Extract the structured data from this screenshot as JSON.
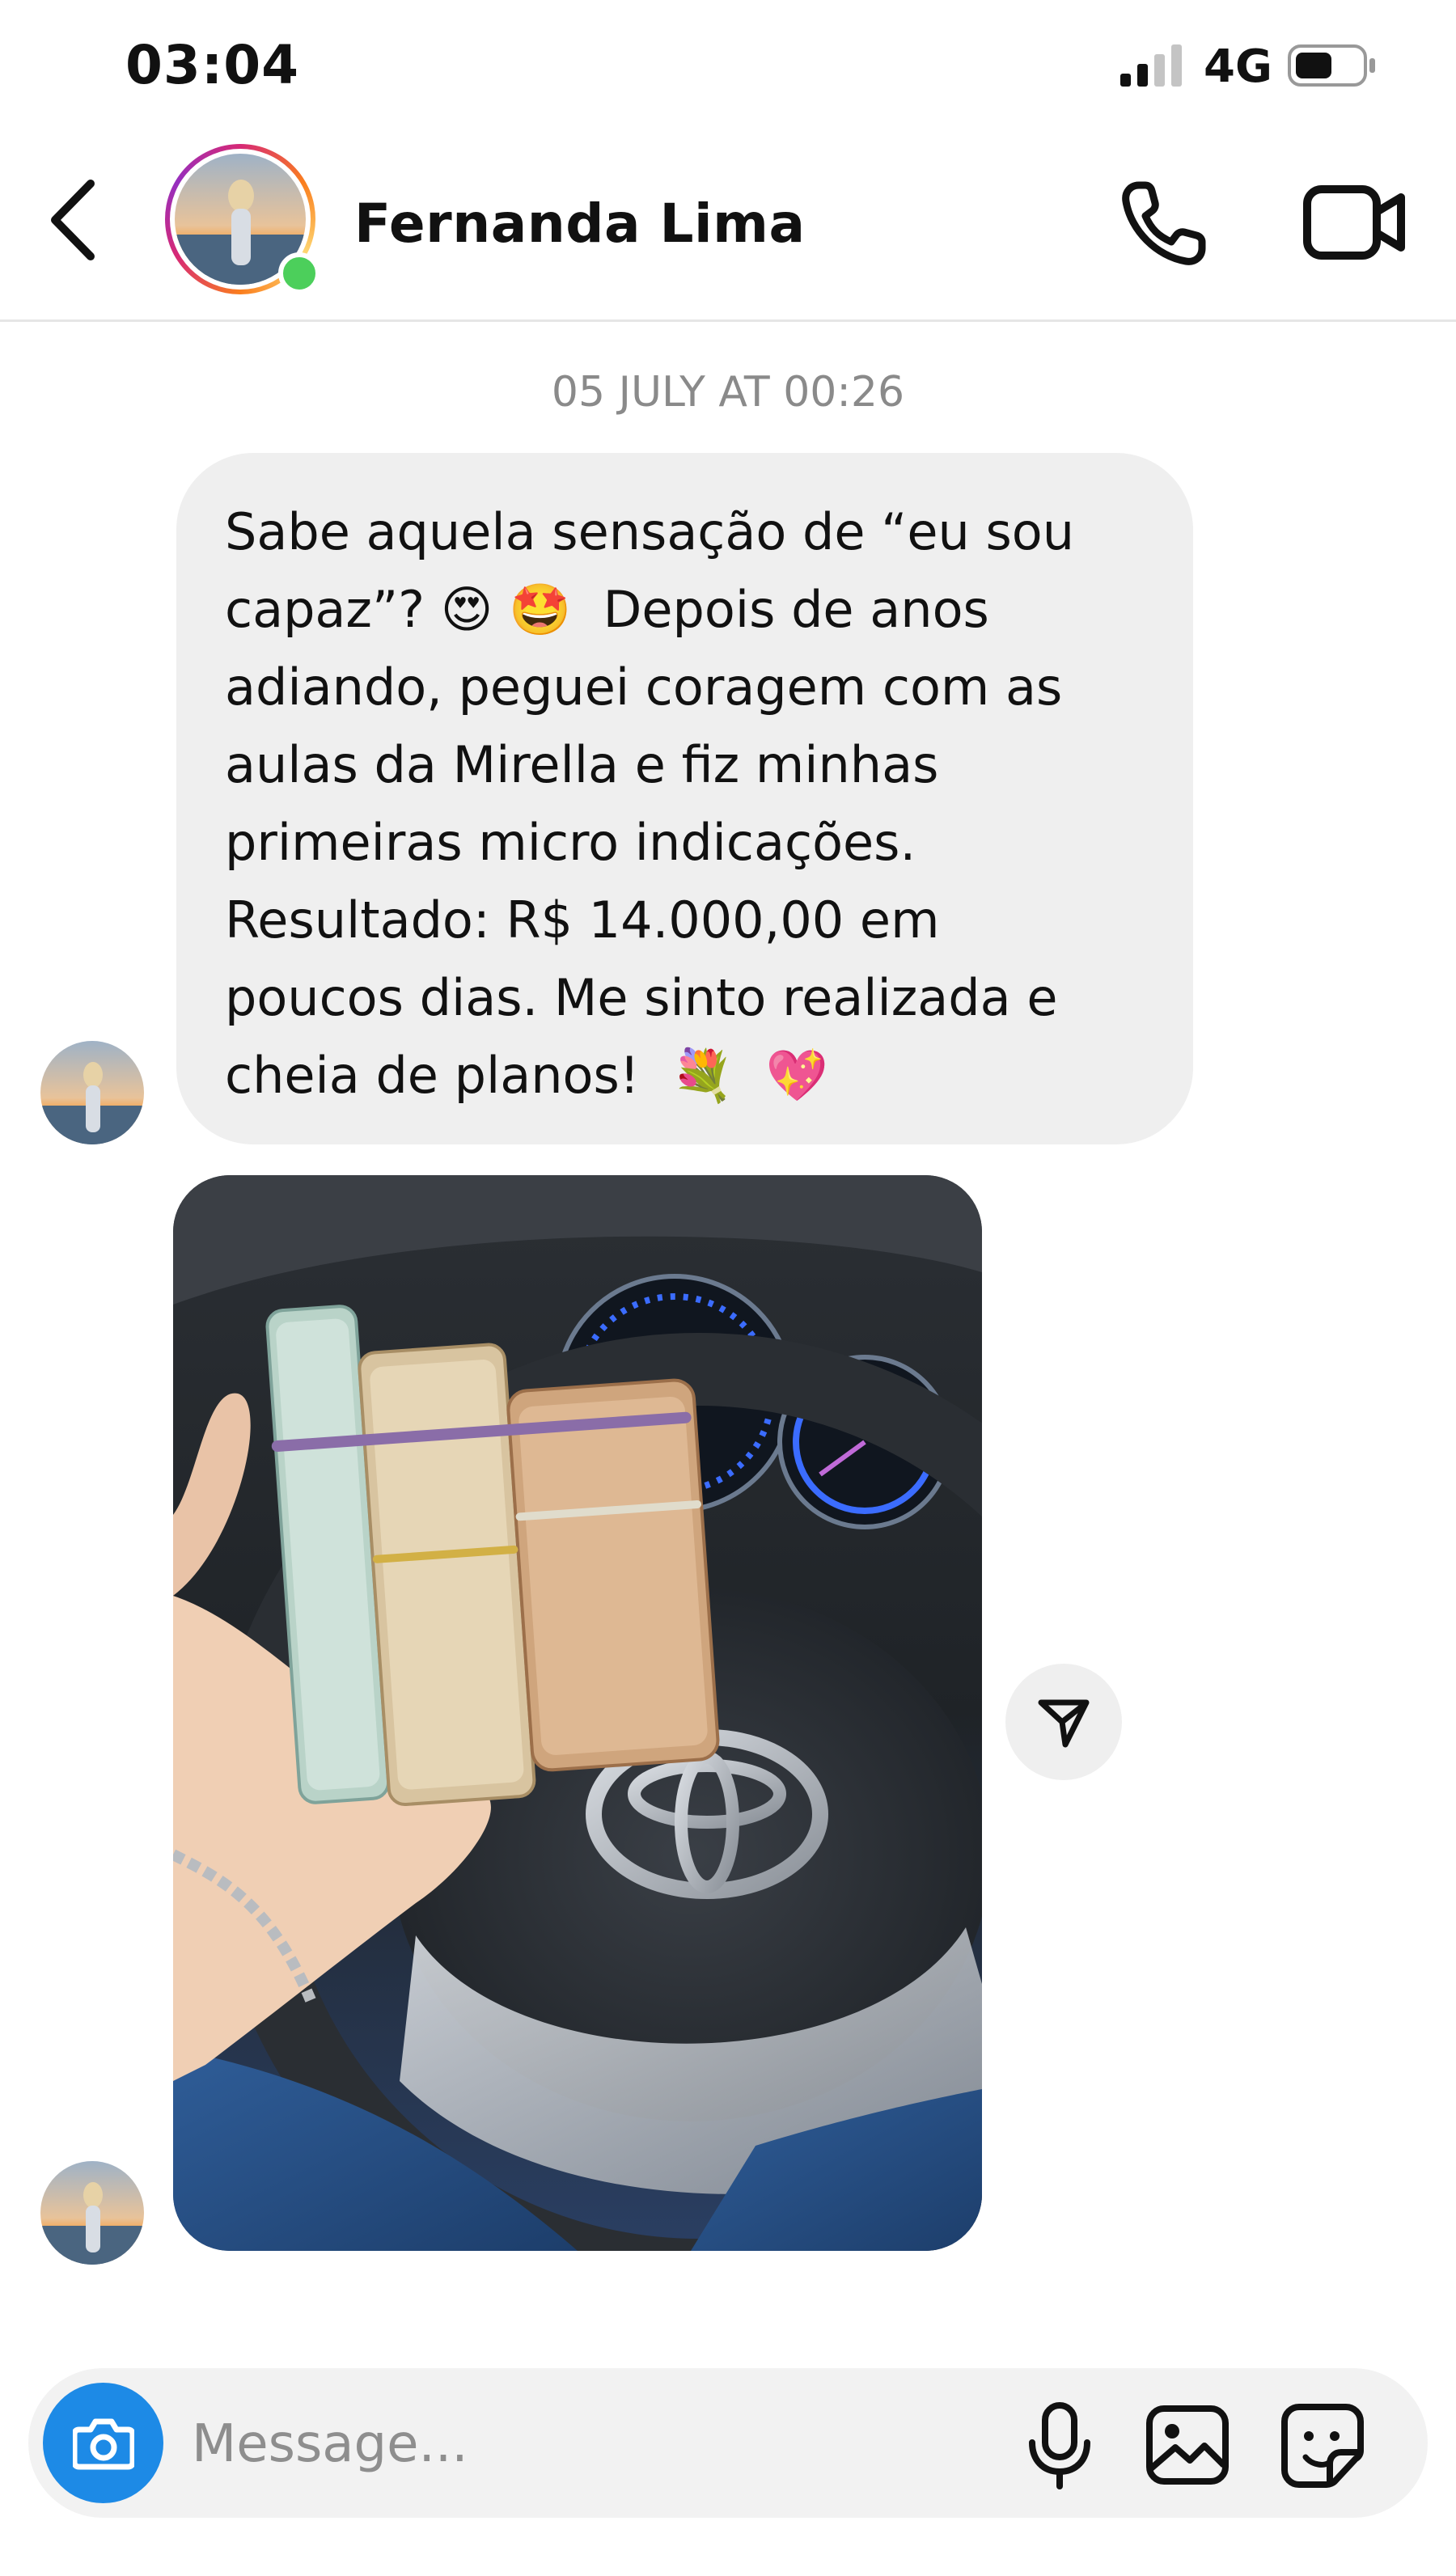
{
  "status_bar": {
    "time": "03:04",
    "network": "4G"
  },
  "header": {
    "contact_name": "Fernanda Lima"
  },
  "chat": {
    "date_separator": "05 JULY AT 00:26",
    "messages": [
      {
        "type": "text",
        "text": "Sabe aquela sensação de “eu sou\ncapaz”? 😍 🤩  Depois de anos\nadiando, peguei coragem com as\naulas da Mirella e fiz minhas\nprimeiras micro indicações.\nResultado: R$ 14.000,00 em\npoucos dias. Me sinto realizada e\ncheia de planos!  💐  💖"
      },
      {
        "type": "image"
      }
    ]
  },
  "composer": {
    "placeholder": "Message..."
  },
  "icons": {
    "back": "chevron-left-icon",
    "call": "phone-icon",
    "video": "video-camera-icon",
    "share": "send-icon",
    "camera": "camera-icon",
    "mic": "microphone-icon",
    "gallery": "image-icon",
    "sticker": "sticker-icon"
  },
  "colors": {
    "bubble_bg": "#efefef",
    "camera_button": "#1d8ae6",
    "online": "#4ccf5b",
    "date_text": "#8a8a8a"
  }
}
